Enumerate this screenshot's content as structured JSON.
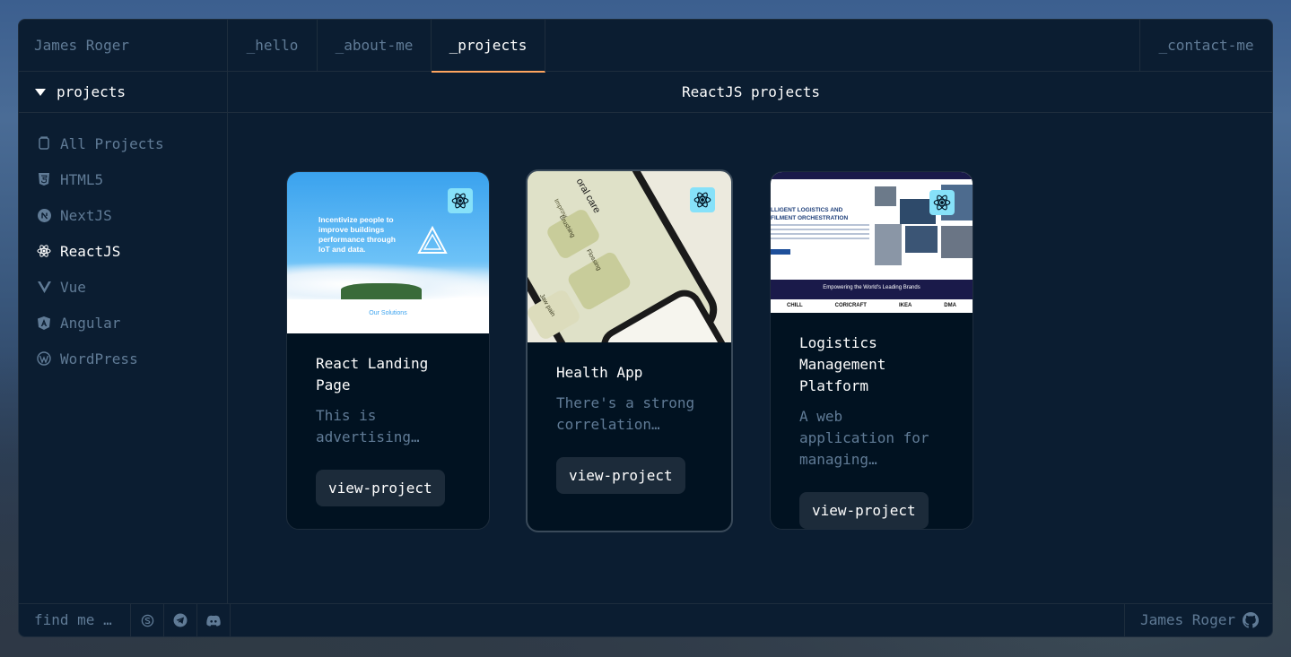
{
  "header": {
    "brand": "James Roger",
    "tabs": [
      {
        "label": "_hello"
      },
      {
        "label": "_about-me"
      },
      {
        "label": "_projects"
      }
    ],
    "contact": "_contact-me"
  },
  "sidebar": {
    "section_title": "projects",
    "items": [
      {
        "label": "All Projects",
        "icon": "copy-icon"
      },
      {
        "label": "HTML5",
        "icon": "html5-icon"
      },
      {
        "label": "NextJS",
        "icon": "nextjs-icon"
      },
      {
        "label": "ReactJS",
        "icon": "react-icon"
      },
      {
        "label": "Vue",
        "icon": "vue-icon"
      },
      {
        "label": "Angular",
        "icon": "angular-icon"
      },
      {
        "label": "WordPress",
        "icon": "wordpress-icon"
      }
    ]
  },
  "main": {
    "title": "ReactJS projects",
    "cards": [
      {
        "title": "React Landing Page",
        "description": "This is advertising…",
        "button": "view-project",
        "thumb": {
          "headline": "Incentivize people to improve buildings performance through IoT and data.",
          "cta": "Our Solutions"
        }
      },
      {
        "title": "Health App",
        "description": "There's a strong correlation…",
        "button": "view-project",
        "thumb": {
          "heading": "oral care",
          "labels": [
            "Improve",
            "Brushing",
            "Flossing",
            "Jaw pain"
          ]
        }
      },
      {
        "title": "Logistics Management Platform",
        "description": "A web application for managing…",
        "button": "view-project",
        "thumb": {
          "headline": "LLIGENT LOGISTICS AND FILMENT ORCHESTRATION",
          "banner": "Empowering the World's Leading Brands",
          "brands": [
            "CHILL",
            "CORICRAFT",
            "IKEA",
            "DMA"
          ]
        }
      }
    ]
  },
  "footer": {
    "find_me": "find me …",
    "socials": [
      "skype-icon",
      "telegram-icon",
      "discord-icon"
    ],
    "user": "James Roger"
  },
  "colors": {
    "accent": "#fea55f",
    "muted": "#607b96",
    "react_badge": "#86e1f9"
  }
}
